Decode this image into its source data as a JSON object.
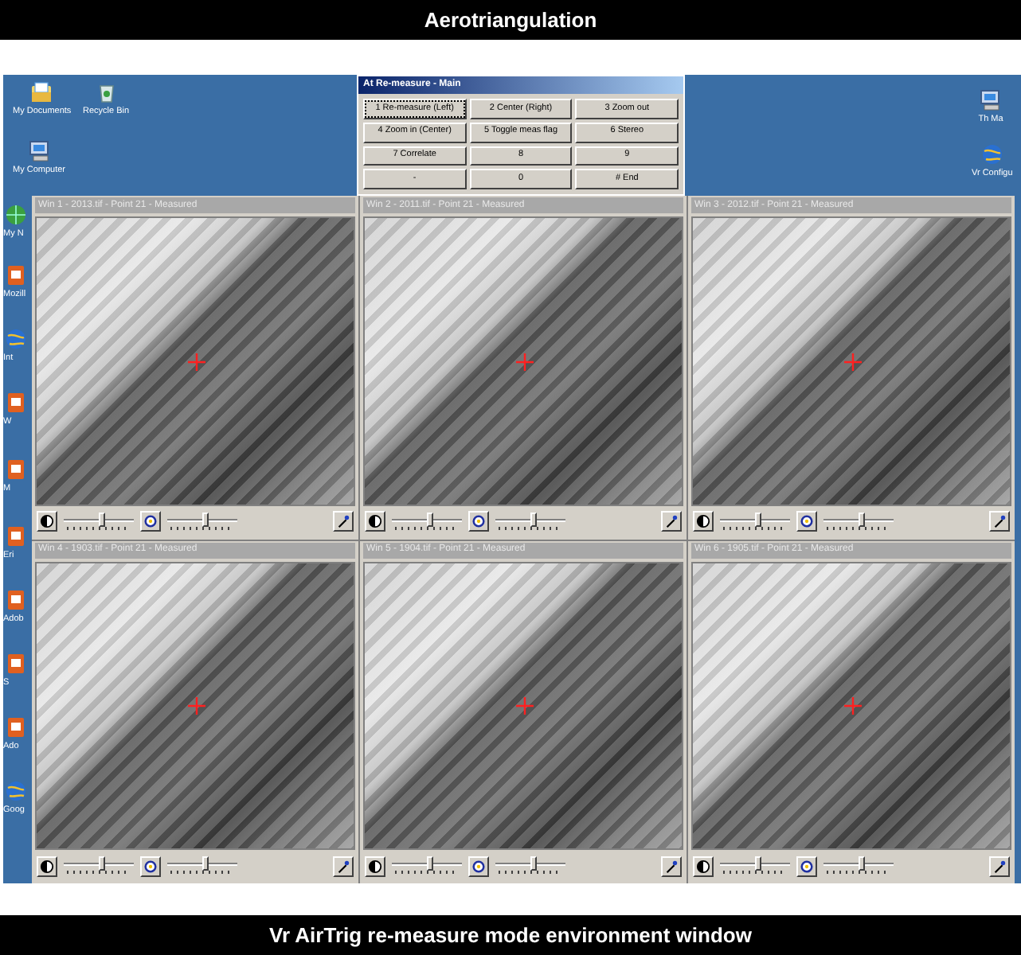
{
  "header": {
    "title": "Aerotriangulation"
  },
  "desktop": {
    "icons": [
      {
        "kind": "documents",
        "label": "My Documents"
      },
      {
        "kind": "recycle",
        "label": "Recycle Bin"
      },
      {
        "kind": "computer",
        "label": "My Computer"
      },
      {
        "kind": "network",
        "label": "My N"
      },
      {
        "kind": "app",
        "label": "Mozill"
      },
      {
        "kind": "browser",
        "label": "Int"
      },
      {
        "kind": "app",
        "label": "W"
      },
      {
        "kind": "app",
        "label": "M"
      },
      {
        "kind": "app",
        "label": "Eri"
      },
      {
        "kind": "app",
        "label": "Adob"
      },
      {
        "kind": "app",
        "label": "S"
      },
      {
        "kind": "app",
        "label": "Ado"
      },
      {
        "kind": "browser",
        "label": "Goog"
      },
      {
        "kind": "computer",
        "label": "Th Ma"
      },
      {
        "kind": "browser",
        "label": "Vr Configu"
      }
    ]
  },
  "dialog": {
    "title": "At Re-measure - Main",
    "buttons": [
      {
        "label": "1 Re-measure (Left)",
        "selected": true
      },
      {
        "label": "2 Center (Right)",
        "selected": false
      },
      {
        "label": "3 Zoom out",
        "selected": false
      },
      {
        "label": "4 Zoom in (Center)",
        "selected": false
      },
      {
        "label": "5 Toggle meas flag",
        "selected": false
      },
      {
        "label": "6 Stereo",
        "selected": false
      },
      {
        "label": "7 Correlate",
        "selected": false
      },
      {
        "label": "8",
        "selected": false
      },
      {
        "label": "9",
        "selected": false
      },
      {
        "label": "-",
        "selected": false
      },
      {
        "label": "0",
        "selected": false
      },
      {
        "label": "# End",
        "selected": false
      }
    ]
  },
  "windows": [
    {
      "title": "Win 1 - 2013.tif - Point 21 - Measured",
      "sliders": [
        {
          "level": 0.55
        },
        {
          "level": 0.55
        }
      ]
    },
    {
      "title": "Win 2 - 2011.tif - Point 21 - Measured",
      "sliders": [
        {
          "level": 0.55
        },
        {
          "level": 0.55
        }
      ]
    },
    {
      "title": "Win 3 - 2012.tif - Point 21 - Measured",
      "sliders": [
        {
          "level": 0.55
        },
        {
          "level": 0.55
        }
      ]
    },
    {
      "title": "Win 4 - 1903.tif - Point 21 - Measured",
      "sliders": [
        {
          "level": 0.55
        },
        {
          "level": 0.55
        }
      ]
    },
    {
      "title": "Win 5 - 1904.tif - Point 21 - Measured",
      "sliders": [
        {
          "level": 0.55
        },
        {
          "level": 0.55
        }
      ]
    },
    {
      "title": "Win 6 - 1905.tif - Point 21 - Measured",
      "sliders": [
        {
          "level": 0.55
        },
        {
          "level": 0.55
        }
      ]
    }
  ],
  "caption": "Vr AirTrig re-measure mode environment window"
}
